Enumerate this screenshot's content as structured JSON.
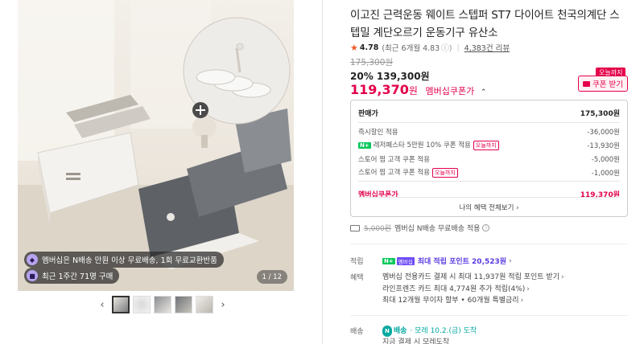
{
  "product": {
    "title": "이고진 근력운동 웨이트 스텝퍼 ST7 다이어트 천국의계단 스텝밀 계단오르기 운동기구 유산소",
    "rating_score": "4.78",
    "rating_recent": "(최근 6개월 4.83",
    "review_count": "4,383건 리뷰",
    "original_price": "175,300원",
    "discount_line": "20% 139,300원",
    "member_price": "119,370",
    "member_price_unit": "원",
    "member_coupon_label": "멤버십쿠폰가",
    "today_badge": "오늘까지",
    "coupon_button": "쿠폰 받기"
  },
  "gallery": {
    "banner_1": "멤버십은 N배송 만원 이상 무료배송, 1회 무료교환반품",
    "banner_2": "최근 1주간 71명 구매",
    "counter": "1 / 12",
    "prev_icon": "chevron-left-icon",
    "next_icon": "chevron-right-icon"
  },
  "price_breakdown": {
    "rows": [
      {
        "label": "판매가",
        "value": "175,300원"
      },
      {
        "label": "즉시할인 적용",
        "value": "-36,000원"
      },
      {
        "label": "레저페스타 5만원 10% 쿠폰 적용",
        "value": "-13,930원",
        "badge": "오늘까지",
        "npay": "N+"
      },
      {
        "label": "스토어 찜 고객 쿠폰 적용",
        "value": "-5,000원"
      },
      {
        "label": "스토어 찜 고객 쿠폰 적용",
        "value": "-1,000원",
        "badge": "오늘까지"
      }
    ],
    "total_label": "멤버십쿠폰가",
    "total_value": "119,370원",
    "more_label": "나의 혜택 전체보기 ›"
  },
  "shipping": {
    "old_fee": "5,000원",
    "text": "멤버십 N배송 무료배송 적용"
  },
  "points": {
    "label": "적립",
    "badge_n": "N+",
    "badge_member": "멤버십",
    "text": "최대 적립 포인트 20,523원",
    "arrow": "›"
  },
  "benefits": {
    "label": "혜택",
    "line1": "멤버십 전용카드 결제 시 최대 11,937원 적립 포인트 받기",
    "line2": "라인프렌즈 카드 최대 4,774원 추가 적립(4%)",
    "line3": "최대 12개월 무이자 할부 • 60개월 특별금리"
  },
  "delivery": {
    "label": "배송",
    "badge": "N",
    "brand": "배송",
    "date": "· 모레 10.2.(금) 도착",
    "sub": "지금 결제 시 모레도착"
  },
  "colors": {
    "accent": "#e4004a",
    "naver_green": "#03c75a",
    "member_purple": "#5a3be0",
    "delivery_teal": "#03a9a0"
  }
}
